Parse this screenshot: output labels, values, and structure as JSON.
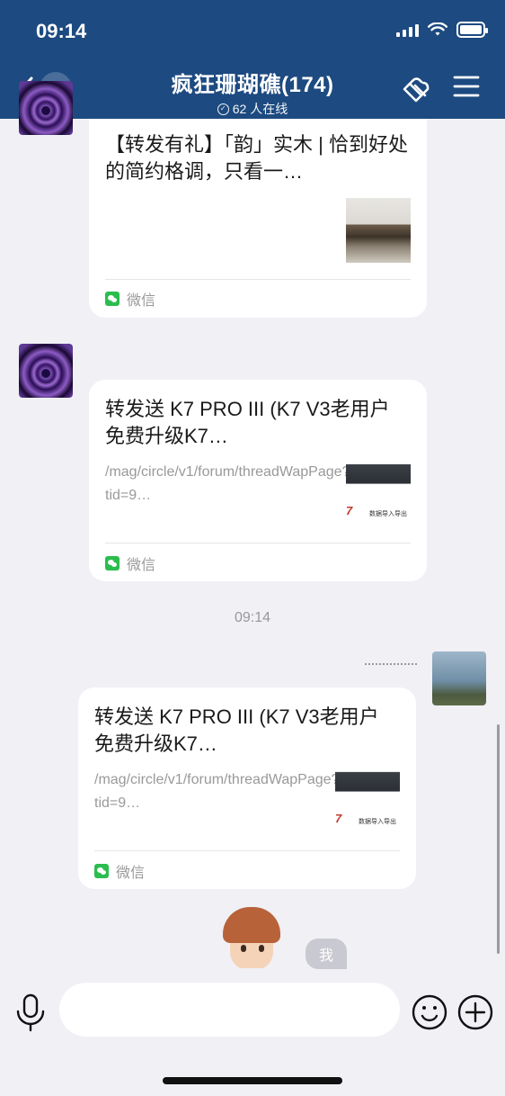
{
  "status_bar": {
    "time": "09:14"
  },
  "header": {
    "back_badge": "4",
    "title": "疯狂珊瑚礁(174)",
    "online": "62 人在线",
    "icons": [
      "chevron-left-icon",
      "link-icon",
      "menu-icon"
    ]
  },
  "messages": [
    {
      "title": "【转发有礼】「韵」实木 | 恰到好处的简约格调，只看一…",
      "desc": "",
      "source": "微信",
      "thumb": "living-room"
    },
    {
      "title": "转发送 K7 PRO III (K7 V3老用户免费升级K7…",
      "desc": "/mag/circle/v1/forum/threadWapPage?tid=9…",
      "source": "微信",
      "thumb": "k7-screen",
      "thumb_text": "7",
      "thumb_caption": "数据导入导出"
    },
    {
      "title": "转发送 K7 PRO III (K7 V3老用户免费升级K7…",
      "desc": "/mag/circle/v1/forum/threadWapPage?tid=9…",
      "source": "微信",
      "thumb": "k7-screen",
      "thumb_text": "7",
      "thumb_caption": "数据导入导出"
    }
  ],
  "timestamp": "09:14",
  "sticker_label": "我",
  "input": {
    "placeholder": ""
  },
  "colors": {
    "header": "#1d4a80",
    "wechat_green": "#2bbd4e",
    "background": "#f0f0f5"
  }
}
